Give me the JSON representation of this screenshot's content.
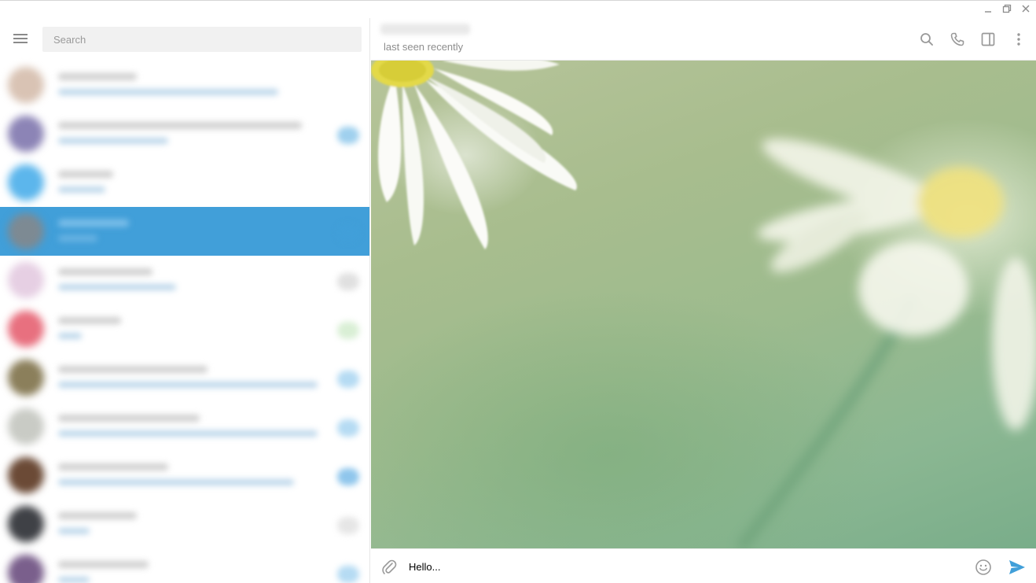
{
  "window": {
    "controls": [
      "minimize-icon",
      "restore-icon",
      "close-icon"
    ]
  },
  "sidebar": {
    "search_placeholder": "Search",
    "chats": [
      {
        "avatar_color": "#d9c3b4",
        "badge_color": "#ffffff"
      },
      {
        "avatar_color": "#8c84b6",
        "badge_color": "#9fd0ee"
      },
      {
        "avatar_color": "#5cb6ec",
        "badge_color": "#ffffff"
      },
      {
        "avatar_color": "#7d8a93",
        "badge_color": "#419fd9",
        "active": true
      },
      {
        "avatar_color": "#e6cfe3",
        "badge_color": "#e0e0e0"
      },
      {
        "avatar_color": "#e8707f",
        "badge_color": "#d9efd5"
      },
      {
        "avatar_color": "#8b7f5b",
        "badge_color": "#b5dbf3"
      },
      {
        "avatar_color": "#c9cbc5",
        "badge_color": "#b5dbf3"
      },
      {
        "avatar_color": "#6b4a36",
        "badge_color": "#8fc6ec"
      },
      {
        "avatar_color": "#3f4146",
        "badge_color": "#e6e6e6"
      },
      {
        "avatar_color": "#7a5f8c",
        "badge_color": "#b5dbf3"
      }
    ]
  },
  "chat": {
    "peer_status": "last seen recently",
    "header_icons": [
      "search-icon",
      "phone-icon",
      "sidebar-toggle-icon",
      "more-icon"
    ],
    "composer_value": "Hello...",
    "accent_color": "#419fd9"
  }
}
